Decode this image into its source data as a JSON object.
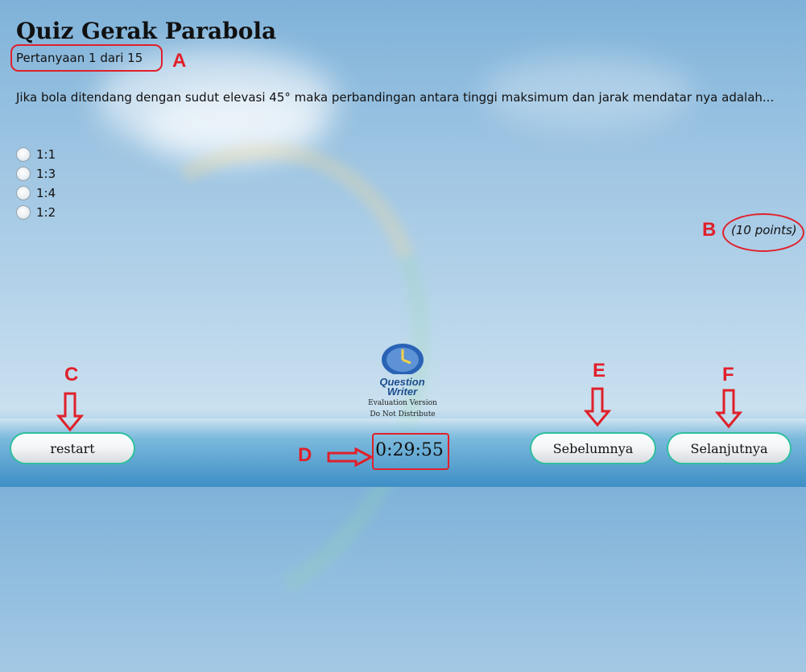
{
  "quiz": {
    "title": "Quiz Gerak Parabola",
    "question_number": "Pertanyaan 1 dari 15",
    "question_text": "Jika bola ditendang dengan sudut elevasi 45° maka perbandingan antara tinggi maksimum dan jarak mendatar nya adalah...",
    "options": [
      "1:1",
      "1:3",
      "1:4",
      "1:2"
    ],
    "points": "(10 points)"
  },
  "controls": {
    "restart_label": "restart",
    "previous_label": "Sebelumnya",
    "next_label": "Selanjutnya",
    "timer": "0:29:55"
  },
  "branding": {
    "logo_line1": "Question",
    "logo_line2": "Writer",
    "eval_line1": "Evaluation Version",
    "eval_line2": "Do Not Distribute"
  },
  "annotations": {
    "a": "A",
    "b": "B",
    "c": "C",
    "d": "D",
    "e": "E",
    "f": "F",
    "color": "#e0202a"
  }
}
